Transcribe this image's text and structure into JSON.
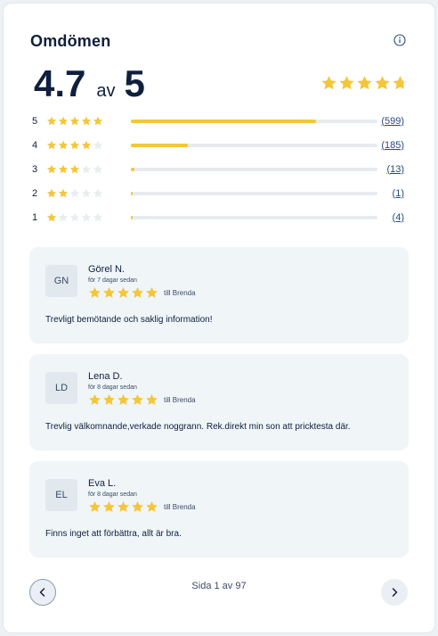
{
  "title": "Omdömen",
  "info_icon": "info-circle-icon",
  "rating": {
    "score": "4.7",
    "av": "av",
    "max": "5",
    "stars_filled": 4.7
  },
  "distribution": [
    {
      "stars": "5",
      "filled": 5,
      "fraction": 0.75,
      "count": "(599)"
    },
    {
      "stars": "4",
      "filled": 4,
      "fraction": 0.23,
      "count": "(185)"
    },
    {
      "stars": "3",
      "filled": 3,
      "fraction": 0.016,
      "count": "(13)"
    },
    {
      "stars": "2",
      "filled": 2,
      "fraction": 0.003,
      "count": "(1)"
    },
    {
      "stars": "1",
      "filled": 1,
      "fraction": 0.006,
      "count": "(4)"
    }
  ],
  "reviews": [
    {
      "initials": "GN",
      "name": "Görel N.",
      "date": "för 7 dagar sedan",
      "stars": 5,
      "to": "till Brenda",
      "text": "Trevligt bemötande och saklig information!"
    },
    {
      "initials": "LD",
      "name": "Lena D.",
      "date": "för 8 dagar sedan",
      "stars": 5,
      "to": "till Brenda",
      "text": "Trevlig välkomnande,verkade noggrann. Rek.direkt min son att pricktesta där."
    },
    {
      "initials": "EL",
      "name": "Eva L.",
      "date": "för 8 dagar sedan",
      "stars": 5,
      "to": "till Brenda",
      "text": "Finns inget att förbättra, allt är bra."
    }
  ],
  "pagination": {
    "text": "Sida 1 av 97",
    "prev_icon": "chevron-left-icon",
    "next_icon": "chevron-right-icon"
  },
  "colors": {
    "star": "#f5c63a",
    "star_empty": "#e8eef0",
    "navy": "#0f1f3d"
  }
}
